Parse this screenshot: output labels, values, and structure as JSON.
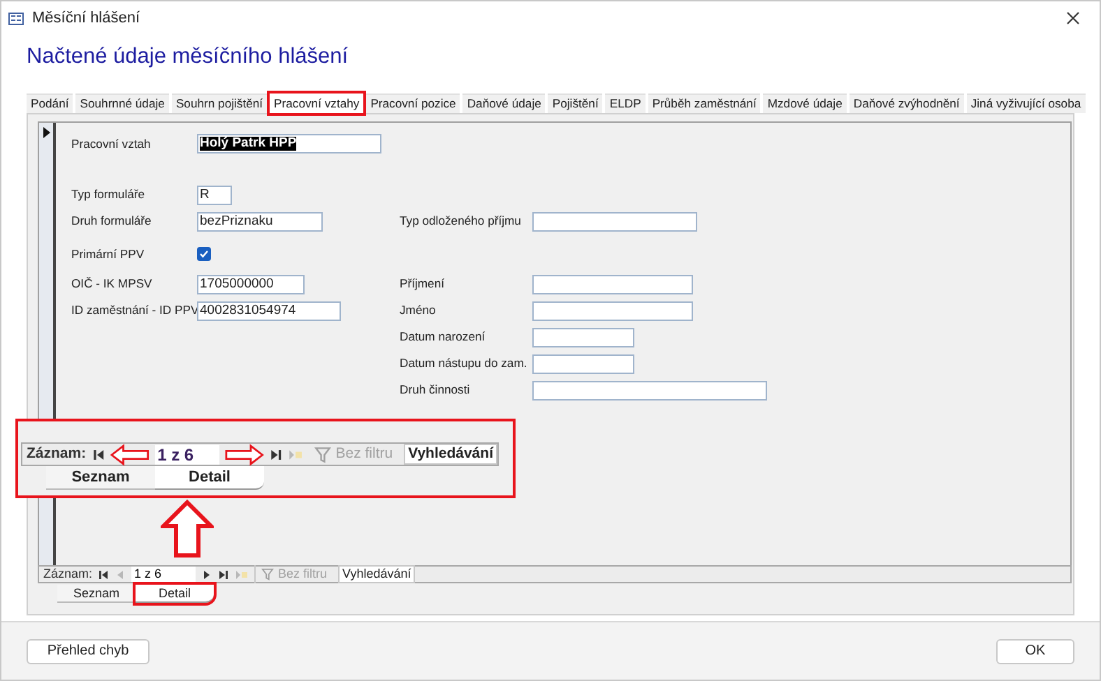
{
  "window": {
    "title": "Měsíční hlášení"
  },
  "heading": "Načtené údaje měsíčního hlášení",
  "tabs": [
    {
      "label": "Podání",
      "selected": false
    },
    {
      "label": "Souhrnné údaje",
      "selected": false
    },
    {
      "label": "Souhrn pojištění",
      "selected": false
    },
    {
      "label": "Pracovní vztahy",
      "selected": true
    },
    {
      "label": "Pracovní pozice",
      "selected": false
    },
    {
      "label": "Daňové údaje",
      "selected": false
    },
    {
      "label": "Pojištění",
      "selected": false
    },
    {
      "label": "ELDP",
      "selected": false
    },
    {
      "label": "Průběh zaměstnání",
      "selected": false
    },
    {
      "label": "Mzdové údaje",
      "selected": false
    },
    {
      "label": "Daňové zvýhodnění",
      "selected": false
    },
    {
      "label": "Jiná vyživující osoba",
      "selected": false
    }
  ],
  "form": {
    "top": {
      "label": "Pracovní vztah",
      "value": "Holý Patrk HPP",
      "highlighted": true
    },
    "left": [
      {
        "kind": "text",
        "label": "Typ formuláře",
        "value": "R"
      },
      {
        "kind": "text",
        "label": "Druh formuláře",
        "value": "bezPriznaku"
      },
      {
        "kind": "checkbox",
        "label": "Primární PPV",
        "checked": true
      },
      {
        "kind": "text",
        "label": "OIČ - IK MPSV",
        "value": "1705000000"
      },
      {
        "kind": "text",
        "label": "ID zaměstnání - ID PPV",
        "value": "4002831054974"
      }
    ],
    "right": [
      {
        "label": "Typ odloženého příjmu"
      },
      {
        "label": "Příjmení"
      },
      {
        "label": "Jméno"
      },
      {
        "label": "Datum narození"
      },
      {
        "label": "Datum nástupu do zam."
      },
      {
        "label": "Druh činnosti"
      }
    ]
  },
  "callout": {
    "controls": [
      {
        "kind": "label",
        "text": "Záznam:"
      },
      {
        "kind": "first",
        "disabled": false
      },
      {
        "kind": "callout_left"
      },
      {
        "kind": "position",
        "text": "1 z 6"
      },
      {
        "kind": "callout_right"
      },
      {
        "kind": "last",
        "disabled": false
      },
      {
        "kind": "new",
        "disabled": true
      },
      {
        "kind": "filter",
        "text": "Bez filtru",
        "disabled": true
      },
      {
        "kind": "search",
        "text": "Vyhledávání"
      }
    ],
    "subtabs": [
      {
        "label": "Seznam",
        "selected": false,
        "highlighted": false
      },
      {
        "label": "Detail",
        "selected": true,
        "highlighted": false
      }
    ]
  },
  "record_nav": {
    "controls": [
      {
        "kind": "label",
        "text": "Záznam:"
      },
      {
        "kind": "first",
        "disabled": false
      },
      {
        "kind": "prev",
        "disabled": true
      },
      {
        "kind": "position",
        "text": "1 z 6"
      },
      {
        "kind": "next",
        "disabled": false
      },
      {
        "kind": "last",
        "disabled": false
      },
      {
        "kind": "new",
        "disabled": true
      },
      {
        "kind": "filter",
        "text": "Bez filtru",
        "disabled": true
      },
      {
        "kind": "search",
        "text": "Vyhledávání"
      }
    ],
    "subtabs": [
      {
        "label": "Seznam",
        "selected": false,
        "highlighted": false
      },
      {
        "label": "Detail",
        "selected": true,
        "highlighted": true
      }
    ]
  },
  "footer": {
    "buttons": [
      "Přehled chyb",
      "OK"
    ]
  }
}
